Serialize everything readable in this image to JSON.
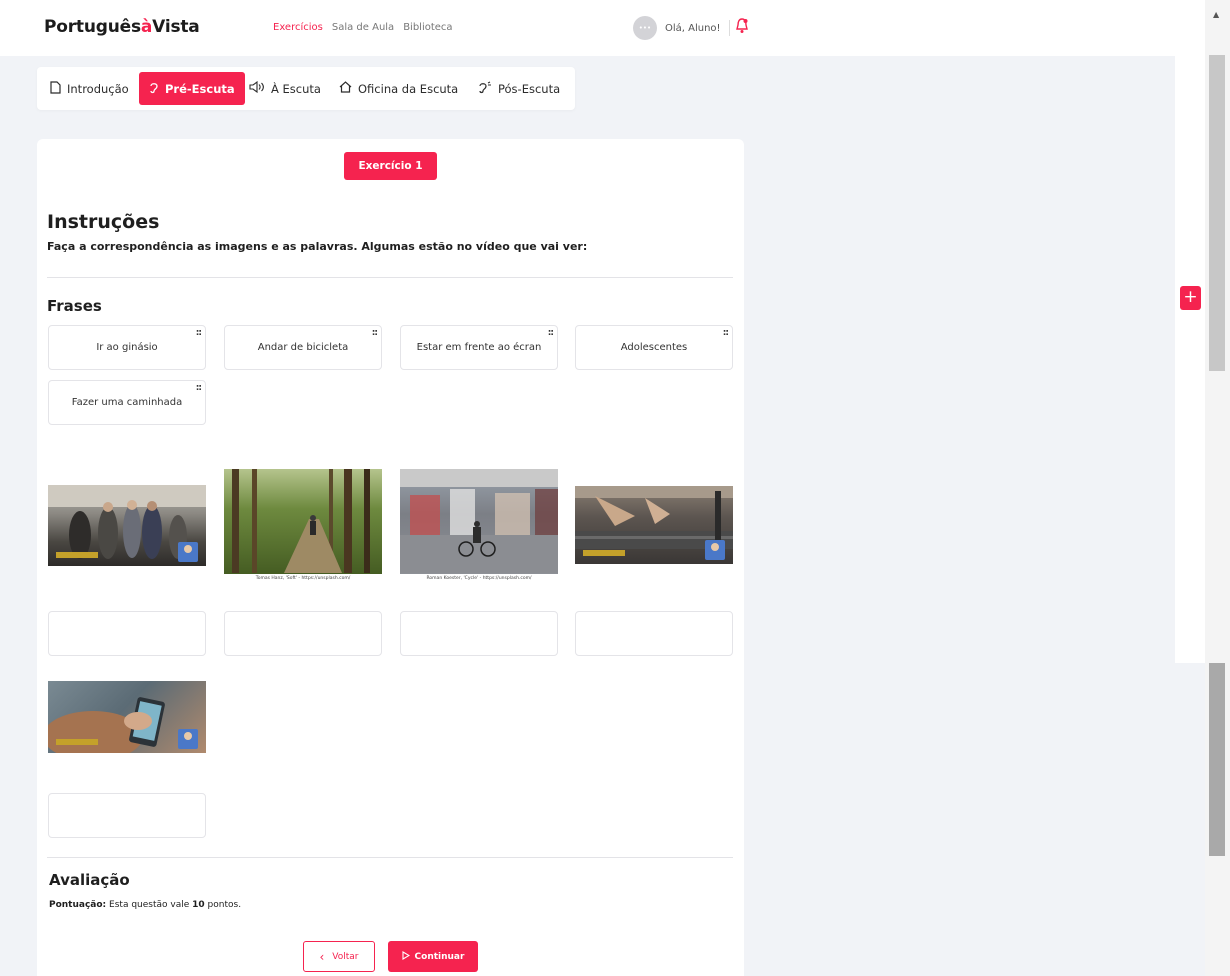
{
  "header": {
    "logo_main": "Português",
    "logo_accent": "à",
    "logo_tail": "Vista",
    "nav": [
      "Exercícios",
      "Sala de Aula",
      "Biblioteca"
    ],
    "greeting": "Olá, Aluno!"
  },
  "tabs": [
    {
      "label": "Introdução",
      "icon": "document-icon",
      "active": false
    },
    {
      "label": "Pré-Escuta",
      "icon": "ear-icon",
      "active": true
    },
    {
      "label": "À Escuta",
      "icon": "speaker-icon",
      "active": false
    },
    {
      "label": "Oficina da Escuta",
      "icon": "house-icon",
      "active": false
    },
    {
      "label": "Pós-Escuta",
      "icon": "ear-sound-icon",
      "active": false
    }
  ],
  "exercise": {
    "button_label": "Exercício 1",
    "instructions_title": "Instruções",
    "instructions_text": "Faça a correspondência as imagens e as palavras. Algumas estão no vídeo que vai ver:",
    "frases_title": "Frases",
    "phrases": [
      "Ir ao ginásio",
      "Andar de bicicleta",
      "Estar em frente ao écran",
      "Adolescentes",
      "Fazer uma caminhada"
    ],
    "images": [
      {
        "icon": "street-crowd-image"
      },
      {
        "icon": "forest-walk-image",
        "caption": "Tomas Hanz, 'Soft' - https://unsplash.com/"
      },
      {
        "icon": "city-bicycle-image",
        "caption": "Roman Koester, 'Cycle' - https://unsplash.com/"
      },
      {
        "icon": "treadmill-image"
      },
      {
        "icon": "phone-screen-image"
      }
    ]
  },
  "evaluation": {
    "title": "Avaliação",
    "score_label": "Pontuação:",
    "score_text_pre": "Esta questão vale",
    "score_points": "10",
    "score_text_post": "pontos."
  },
  "actions": {
    "back_label": "Voltar",
    "continue_label": "Continuar"
  },
  "colors": {
    "accent": "#f5234f",
    "background": "#f1f3f7"
  }
}
